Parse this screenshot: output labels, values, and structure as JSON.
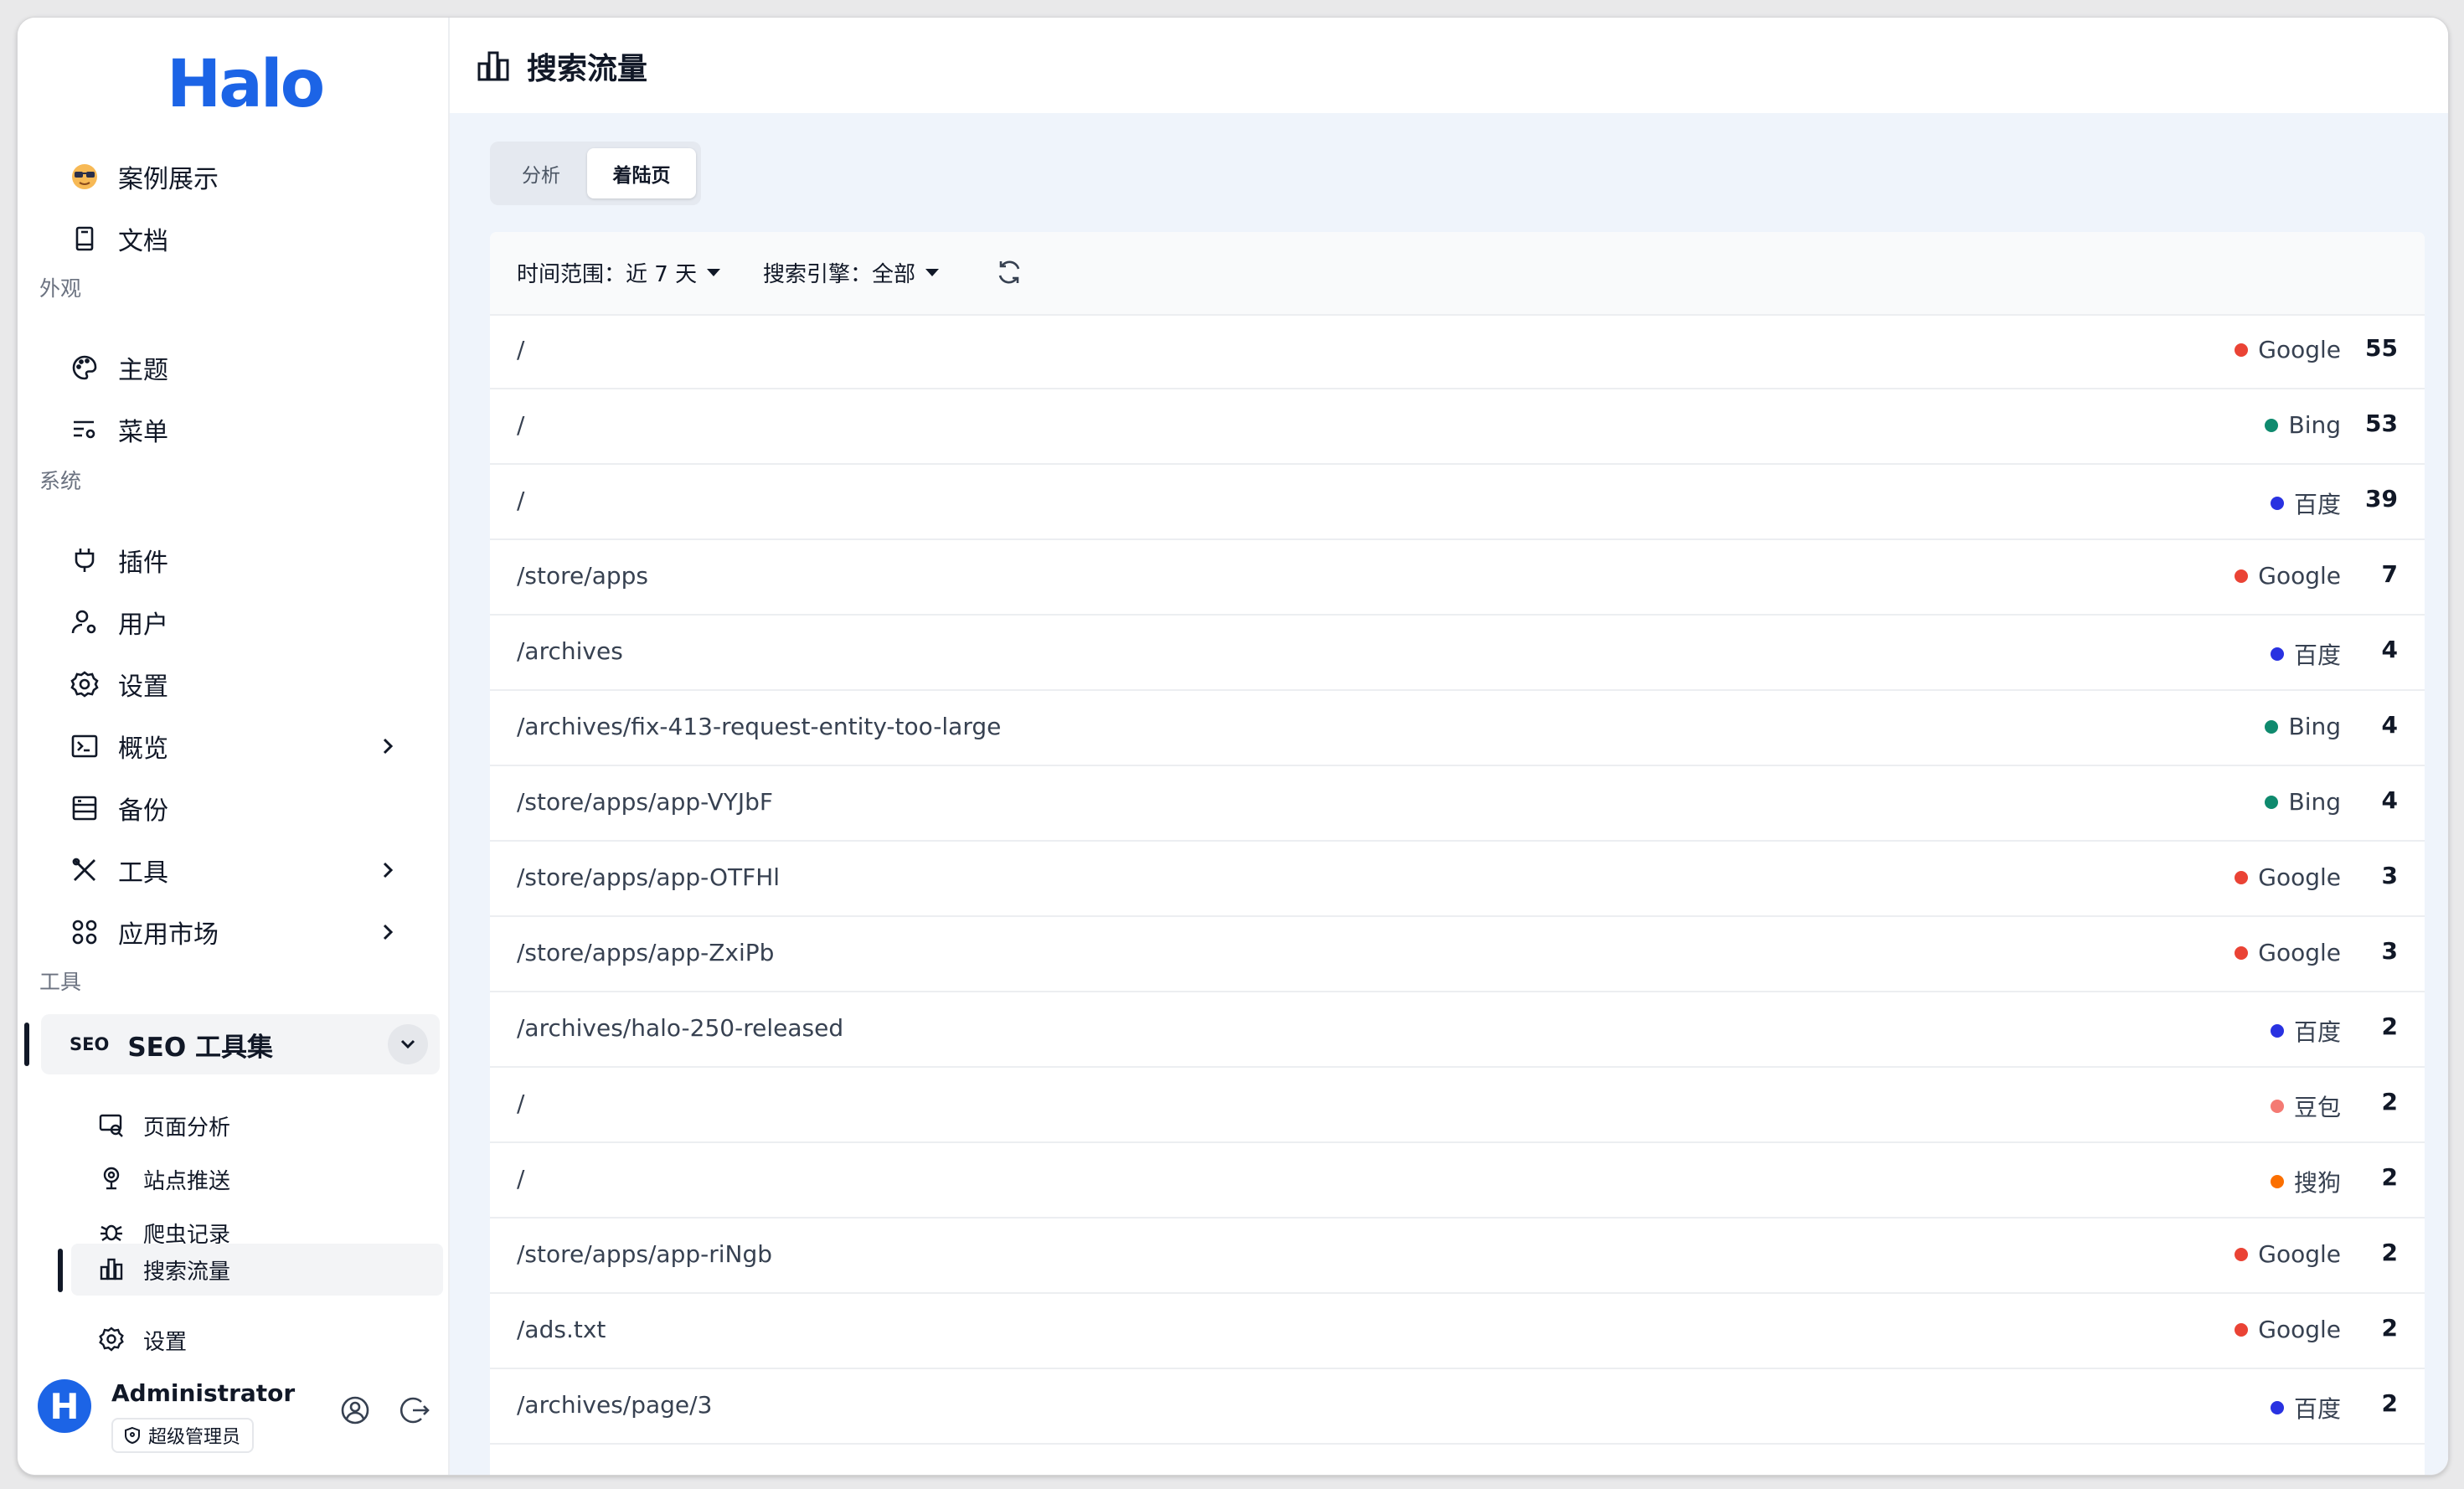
{
  "brand": {
    "name": "Halo",
    "accent": "#1c64e6"
  },
  "sidebar": {
    "top_items": [
      {
        "label": "案例展示",
        "icon": "sunglasses-emoji-icon"
      },
      {
        "label": "文档",
        "icon": "book-icon"
      }
    ],
    "groups": [
      {
        "title": "外观",
        "items": [
          {
            "label": "主题",
            "icon": "palette-icon"
          },
          {
            "label": "菜单",
            "icon": "menu-settings-icon"
          }
        ]
      },
      {
        "title": "系统",
        "items": [
          {
            "label": "插件",
            "icon": "plug-icon"
          },
          {
            "label": "用户",
            "icon": "user-settings-icon"
          },
          {
            "label": "设置",
            "icon": "gear-icon"
          },
          {
            "label": "概览",
            "icon": "terminal-icon",
            "expandable": true
          },
          {
            "label": "备份",
            "icon": "archive-icon"
          },
          {
            "label": "工具",
            "icon": "tools-icon",
            "expandable": true
          },
          {
            "label": "应用市场",
            "icon": "apps-grid-icon",
            "expandable": true
          }
        ]
      },
      {
        "title": "工具"
      }
    ],
    "seo": {
      "label": "SEO 工具集",
      "badge": "SEO",
      "expanded": true,
      "children": [
        {
          "label": "页面分析",
          "icon": "page-search-icon"
        },
        {
          "label": "站点推送",
          "icon": "globe-push-icon"
        },
        {
          "label": "爬虫记录",
          "icon": "bug-icon"
        },
        {
          "label": "搜索流量",
          "icon": "bar-chart-icon",
          "active": true
        },
        {
          "label": "设置",
          "icon": "gear-icon"
        }
      ]
    },
    "user": {
      "avatar_letter": "H",
      "name": "Administrator",
      "role": "超级管理员"
    }
  },
  "header": {
    "title": "搜索流量",
    "icon": "bar-chart-icon"
  },
  "tabs": [
    {
      "label": "分析",
      "active": false
    },
    {
      "label": "着陆页",
      "active": true
    }
  ],
  "filters": {
    "time_range": "时间范围：近 7 天",
    "engine": "搜索引擎：全部"
  },
  "engine_colors": {
    "Google": "#ea4335",
    "Bing": "#0f8a6e",
    "百度": "#2932e1",
    "豆包": "#f47a73",
    "搜狗": "#fb6f00"
  },
  "rows": [
    {
      "path": "/",
      "engine": "Google",
      "count": "55"
    },
    {
      "path": "/",
      "engine": "Bing",
      "count": "53"
    },
    {
      "path": "/",
      "engine": "百度",
      "count": "39"
    },
    {
      "path": "/store/apps",
      "engine": "Google",
      "count": "7"
    },
    {
      "path": "/archives",
      "engine": "百度",
      "count": "4"
    },
    {
      "path": "/archives/fix-413-request-entity-too-large",
      "engine": "Bing",
      "count": "4"
    },
    {
      "path": "/store/apps/app-VYJbF",
      "engine": "Bing",
      "count": "4"
    },
    {
      "path": "/store/apps/app-OTFHl",
      "engine": "Google",
      "count": "3"
    },
    {
      "path": "/store/apps/app-ZxiPb",
      "engine": "Google",
      "count": "3"
    },
    {
      "path": "/archives/halo-250-released",
      "engine": "百度",
      "count": "2"
    },
    {
      "path": "/",
      "engine": "豆包",
      "count": "2"
    },
    {
      "path": "/",
      "engine": "搜狗",
      "count": "2"
    },
    {
      "path": "/store/apps/app-riNgb",
      "engine": "Google",
      "count": "2"
    },
    {
      "path": "/ads.txt",
      "engine": "Google",
      "count": "2"
    },
    {
      "path": "/archives/page/3",
      "engine": "百度",
      "count": "2"
    }
  ]
}
